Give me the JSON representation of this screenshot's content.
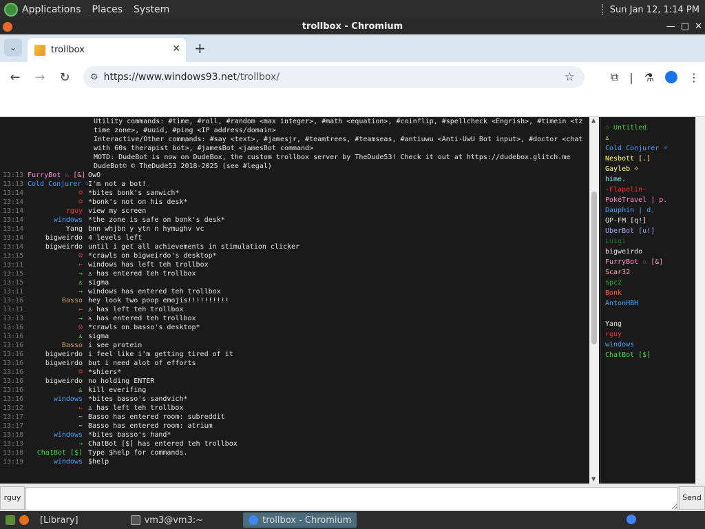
{
  "desktop": {
    "menus": [
      "Applications",
      "Places",
      "System"
    ],
    "datetime": "Sun Jan 12, 1:14 PM"
  },
  "window": {
    "title": "trollbox - Chromium"
  },
  "browser": {
    "tab_title": "trollbox",
    "url_host": "https://www.windows93.net",
    "url_path": "/trollbox/"
  },
  "chat": {
    "system_lines": [
      "Utility commands: #time, #roll, #random <max integer>, #math <equation>, #coinflip, #spellcheck <Engrish>, #timein <tz time zone>, #uuid, #ping <IP address/domain>",
      "Interactive/Other commands: #say <text>, #jamesjr, #teamtrees, #teamseas, #antiuwu <Anti-UwU Bot input>, #doctor <chat with 60s therapist bot>, #jamesBot <jamesBot command>",
      "",
      "MOTD: DudeBot is now on DudeBox, the custom trollbox server by TheDude53! Check it out at https://dudebox.glitch.me",
      "DudeBot© © TheDude53 2018-2025 (see #legal)"
    ],
    "messages": [
      {
        "time": "13:13",
        "nick": "FurryBot ♘ [&]",
        "color": "#ff8fd0",
        "text": "OwO"
      },
      {
        "time": "13:13",
        "nick": "Cold Conjurer ☼",
        "color": "#4aa3ff",
        "text": "I'm not a bot!"
      },
      {
        "time": "13:14",
        "nick": "☺",
        "color": "#ff4444",
        "text": "*bites bonk's sanwich*"
      },
      {
        "time": "13:14",
        "nick": "☺",
        "color": "#ff4444",
        "text": "*bonk's not on his desk*"
      },
      {
        "time": "13:14",
        "nick": "rguy",
        "color": "#ff3333",
        "text": "view my screen"
      },
      {
        "time": "13:14",
        "nick": "windows",
        "color": "#4aa3ff",
        "text": "*the zone is safe on bonk's desk*"
      },
      {
        "time": "13:14",
        "nick": "Yang",
        "color": "#e8e8e8",
        "text": "bnn whjbn y  ytn n hymughv  vc"
      },
      {
        "time": "13:14",
        "nick": "bigweirdo",
        "color": "#e8e8e8",
        "text": "4 levels left"
      },
      {
        "time": "13:14",
        "nick": "bigweirdo",
        "color": "#e8e8e8",
        "text": "until i get all achievements in stimulation clicker"
      },
      {
        "time": "13:15",
        "nick": "☺",
        "color": "#ff4444",
        "text": "*crawls on bigweirdo's desktop*"
      },
      {
        "time": "13:11",
        "nick": "←",
        "color": "#ff4444",
        "text": "windows has left teh trollbox"
      },
      {
        "time": "13:15",
        "nick": "→",
        "color": "#44cc44",
        "text": "♙ has entered teh trollbox"
      },
      {
        "time": "13:15",
        "nick": "♙",
        "color": "#88ff88",
        "text": "sigma"
      },
      {
        "time": "13:11",
        "nick": "→",
        "color": "#44cc44",
        "text": "windows has entered teh trollbox"
      },
      {
        "time": "13:16",
        "nick": "Basso",
        "color": "#c8a060",
        "text": "hey look two poop emojis!!!!!!!!!!"
      },
      {
        "time": "13:11",
        "nick": "←",
        "color": "#ff4444",
        "text": "♙ has left teh trollbox"
      },
      {
        "time": "13:13",
        "nick": "→",
        "color": "#44cc44",
        "text": "♙ has entered teh trollbox"
      },
      {
        "time": "13:16",
        "nick": "☺",
        "color": "#ff4444",
        "text": "*crawls on basso's desktop*"
      },
      {
        "time": "13:16",
        "nick": "♙",
        "color": "#88ff88",
        "text": "sigma"
      },
      {
        "time": "13:16",
        "nick": "Basso",
        "color": "#c8a060",
        "text": "i see protein"
      },
      {
        "time": "13:16",
        "nick": "bigweirdo",
        "color": "#e8e8e8",
        "text": "i feel like i'm getting tired of it"
      },
      {
        "time": "13:16",
        "nick": "bigweirdo",
        "color": "#e8e8e8",
        "text": "but i need alot of efforts"
      },
      {
        "time": "13:16",
        "nick": "☺",
        "color": "#ff4444",
        "text": "*shiers*"
      },
      {
        "time": "13:16",
        "nick": "bigweirdo",
        "color": "#e8e8e8",
        "text": "no holding ENTER"
      },
      {
        "time": "13:16",
        "nick": "♙",
        "color": "#88ff88",
        "text": "kill everifing"
      },
      {
        "time": "13:16",
        "nick": "windows",
        "color": "#4aa3ff",
        "text": "*bites basso's sandvich*"
      },
      {
        "time": "13:12",
        "nick": "←",
        "color": "#ff4444",
        "text": "♙ has left teh trollbox"
      },
      {
        "time": "13:17",
        "nick": "~",
        "color": "#e8e8e8",
        "text": "Basso has entered room: subreddit"
      },
      {
        "time": "13:17",
        "nick": "~",
        "color": "#e8e8e8",
        "text": "Basso has entered room: atrium"
      },
      {
        "time": "13:18",
        "nick": "windows",
        "color": "#4aa3ff",
        "text": "*bites basso's hand*"
      },
      {
        "time": "13:13",
        "nick": "→",
        "color": "#44cc44",
        "text": "ChatBot [$] has entered teh trollbox"
      },
      {
        "time": "13:18",
        "nick": "ChatBot [$]",
        "color": "#44dd44",
        "text": "Type $help for commands."
      },
      {
        "time": "13:19",
        "nick": "windows",
        "color": "#4aa3ff",
        "text": "$help"
      }
    ]
  },
  "users": [
    {
      "name": "♘ Untitled",
      "color": "#44cc44"
    },
    {
      "name": "♙",
      "color": "#ffff66"
    },
    {
      "name": "Cold Conjurer ☼",
      "color": "#4aa3ff"
    },
    {
      "name": "Nesbott [.]",
      "color": "#ffff66"
    },
    {
      "name": "Gayleb ☼",
      "color": "#ffff99"
    },
    {
      "name": "hime.",
      "color": "#88eeff"
    },
    {
      "name": "-Flapolin-",
      "color": "#ff3333"
    },
    {
      "name": "PokéTravel | p.",
      "color": "#ff88cc"
    },
    {
      "name": "  Dauphin | d.",
      "color": "#4aa3ff"
    },
    {
      "name": "QP-FM [q!]",
      "color": "#e8e8e8"
    },
    {
      "name": "UberBot [u!]",
      "color": "#aaaaff"
    },
    {
      "name": "Luigi",
      "color": "#227722"
    },
    {
      "name": "bigweirdo",
      "color": "#e8e8e8"
    },
    {
      "name": "FurryBot ♘ [&]",
      "color": "#ff8fd0"
    },
    {
      "name": "Scar32",
      "color": "#ffaaaa"
    },
    {
      "name": "spc2",
      "color": "#33aa33"
    },
    {
      "name": "Bonk",
      "color": "#ff6633"
    },
    {
      "name": "AntonHBH",
      "color": "#4aa3ff"
    },
    {
      "name": "",
      "color": "#e8e8e8"
    },
    {
      "name": "Yang",
      "color": "#e8e8e8"
    },
    {
      "name": "rguy",
      "color": "#ff3333"
    },
    {
      "name": "windows",
      "color": "#4aa3ff"
    },
    {
      "name": "ChatBot [$]",
      "color": "#44dd44"
    }
  ],
  "input": {
    "nick_label": "rguy",
    "send_label": "Send",
    "value": ""
  },
  "taskbar": {
    "items": [
      "[Library]",
      "vm3@vm3:~",
      "trollbox - Chromium"
    ]
  }
}
